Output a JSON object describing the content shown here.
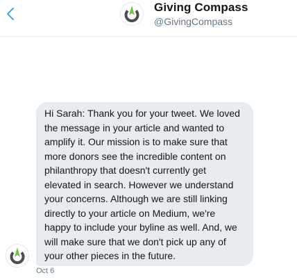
{
  "header": {
    "display_name": "Giving Compass",
    "handle": "@GivingCompass",
    "back_icon": "chevron-left-icon",
    "avatar_icon": "giving-compass-logo"
  },
  "message": {
    "lines": [
      "Hi Sarah: Thank you for your tweet. We loved",
      "the message in your article and wanted to",
      "amplify it. Our mission is to make sure that",
      "more donors see the incredible content on",
      "philanthropy that doesn't currently get",
      "elevated in search. However we understand",
      "your concerns. Although we are still linking",
      "directly to your article on Medium, we're",
      "happy to include your byline as well. And, we",
      "will make sure that we don't pick up any of",
      "your other pieces in the future."
    ],
    "date": "Oct 6",
    "sender_avatar_icon": "giving-compass-logo"
  },
  "colors": {
    "bubble": "#e6ecf0",
    "accent_blue": "#1da1f2",
    "logo_green": "#6cc24a",
    "logo_gray": "#4d4d4f",
    "secondary_text": "#657786"
  }
}
